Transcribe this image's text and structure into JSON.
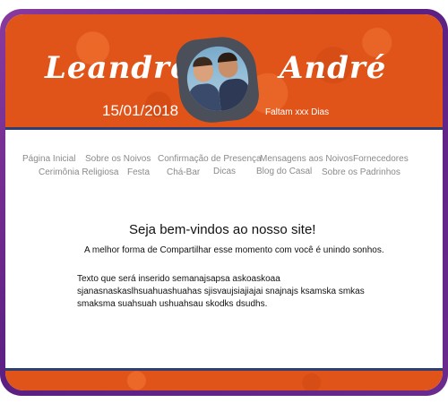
{
  "header": {
    "name_left": "Leandro",
    "name_right": "André",
    "date": "15/01/2018",
    "countdown": "Faltam xxx Dias"
  },
  "nav": {
    "items": [
      "Página Inicial",
      "Sobre os Noivos",
      "Confirmação de Presença",
      "Mensagens aos Noivos",
      "Fornecedores",
      "Cerimônia Religiosa",
      "Festa",
      "Chá-Bar",
      "Dicas",
      "Blog do Casal",
      "Sobre os Padrinhos"
    ]
  },
  "content": {
    "title": "Seja bem-vindos ao nosso site!",
    "subtitle": "A melhor forma de Compartilhar esse momento com você é unindo sonhos.",
    "body": "Texto que será inserido semanajsapsa askoaskoaa sjanasnaskaslhsuahuashuahas sjisvaujsiajiajai snajnajs ksamska smkas smaksma suahsuah ushuahsau skodks dsudhs."
  },
  "colors": {
    "frame": "#6a2a8e",
    "header_bg": "#e0541a",
    "accent_line": "#2f3f74",
    "nav_text": "#8a8a8a"
  }
}
